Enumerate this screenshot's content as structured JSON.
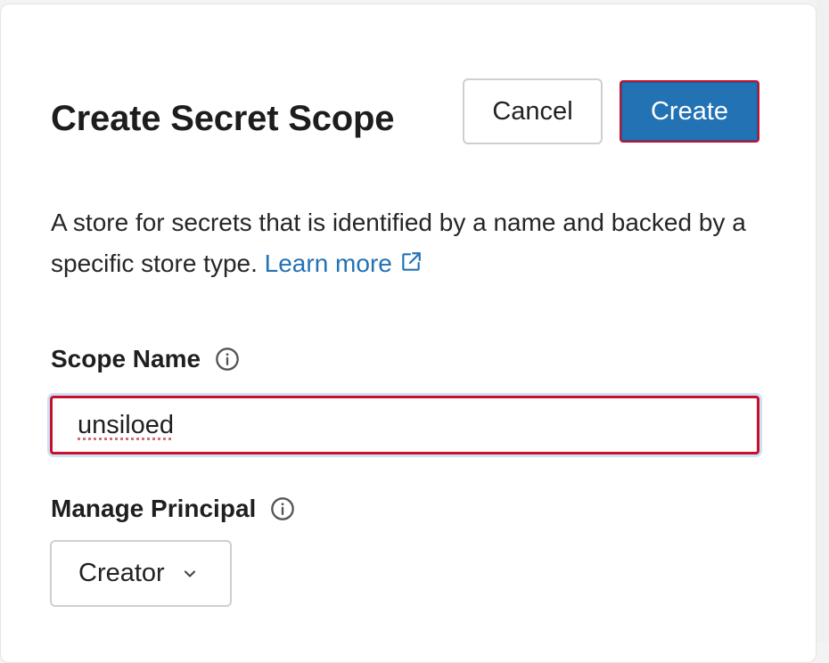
{
  "dialog": {
    "title": "Create Secret Scope",
    "cancel_label": "Cancel",
    "create_label": "Create",
    "description": "A store for secrets that is identified by a name and backed by a specific store type.",
    "learn_more_label": "Learn more",
    "learn_more_icon": "external-link-icon"
  },
  "scope_name": {
    "label": "Scope Name",
    "info_icon": "info-icon",
    "value": "unsiloed"
  },
  "manage_principal": {
    "label": "Manage Principal",
    "info_icon": "info-icon",
    "selected": "Creator",
    "chevron_icon": "chevron-down-icon"
  },
  "colors": {
    "accent": "#2272b4",
    "highlight_outline": "#c8102e"
  }
}
